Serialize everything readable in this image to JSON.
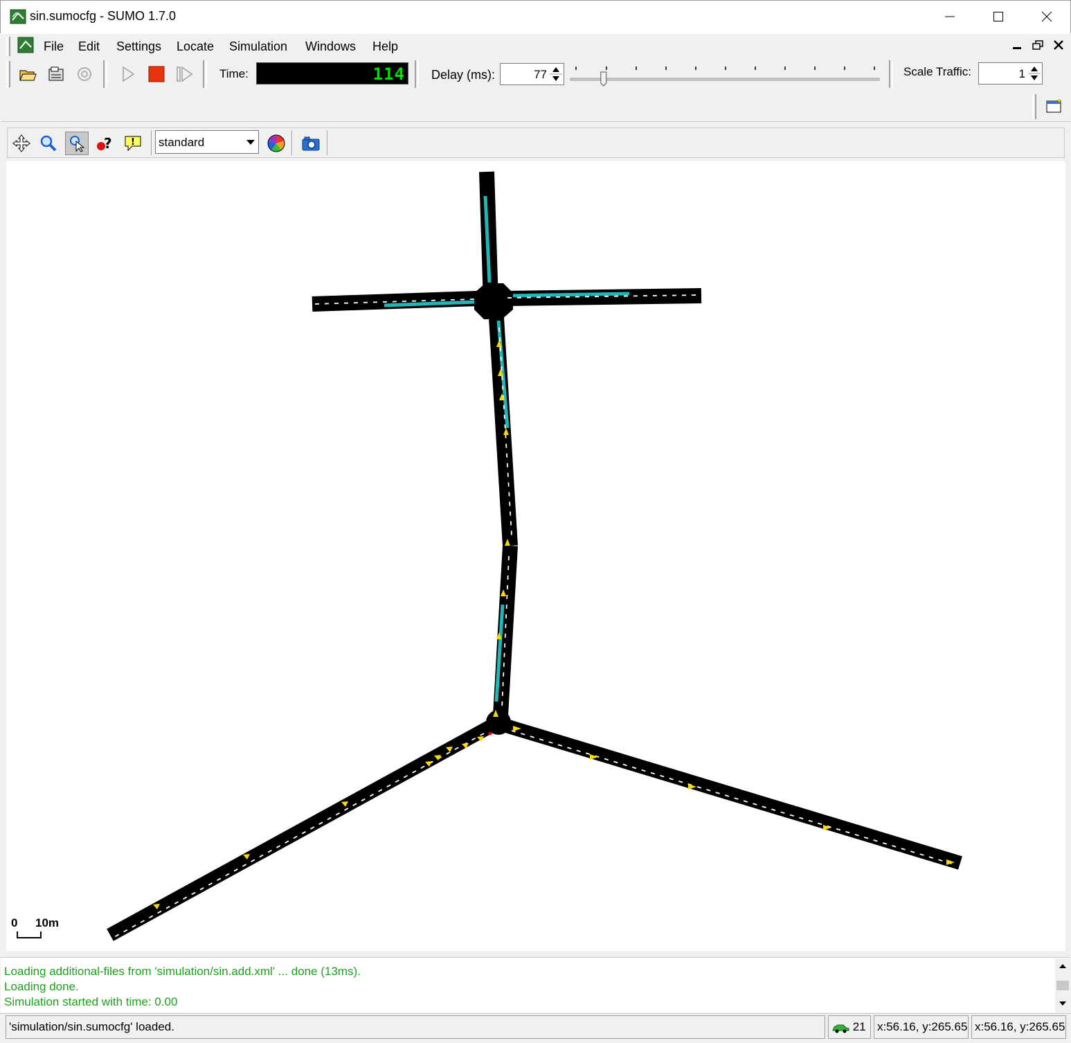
{
  "window": {
    "title": "sin.sumocfg - SUMO 1.7.0",
    "controls": [
      "minimize",
      "maximize",
      "close"
    ]
  },
  "menu": {
    "items": [
      {
        "label": "File"
      },
      {
        "label": "Edit"
      },
      {
        "label": "Settings"
      },
      {
        "label": "Locate"
      },
      {
        "label": "Simulation"
      },
      {
        "label": "Windows"
      },
      {
        "label": "Help"
      }
    ]
  },
  "toolbar": {
    "time_label": "Time:",
    "time_value": "114",
    "delay_label": "Delay (ms):",
    "delay_value": "77",
    "delay_slider_fraction": 0.1,
    "scale_label": "Scale Traffic:",
    "scale_value": "1"
  },
  "viewbar": {
    "scheme": "standard"
  },
  "canvas": {
    "scale_zero": "0",
    "scale_label": "10m",
    "lane_color": "#1fb7b7",
    "vehicle_color": "#ffd800",
    "road_color": "#000000"
  },
  "log": {
    "messages": [
      "Loading additional-files from 'simulation/sin.add.xml' ... done (13ms).",
      "Loading done.",
      "Simulation started with time: 0.00"
    ],
    "color": "#1ea01e"
  },
  "status": {
    "message": "'simulation/sin.sumocfg' loaded.",
    "vehicle_count": "21",
    "coords_1": "x:56.16, y:265.65",
    "coords_2": "x:56.16, y:265.65"
  }
}
